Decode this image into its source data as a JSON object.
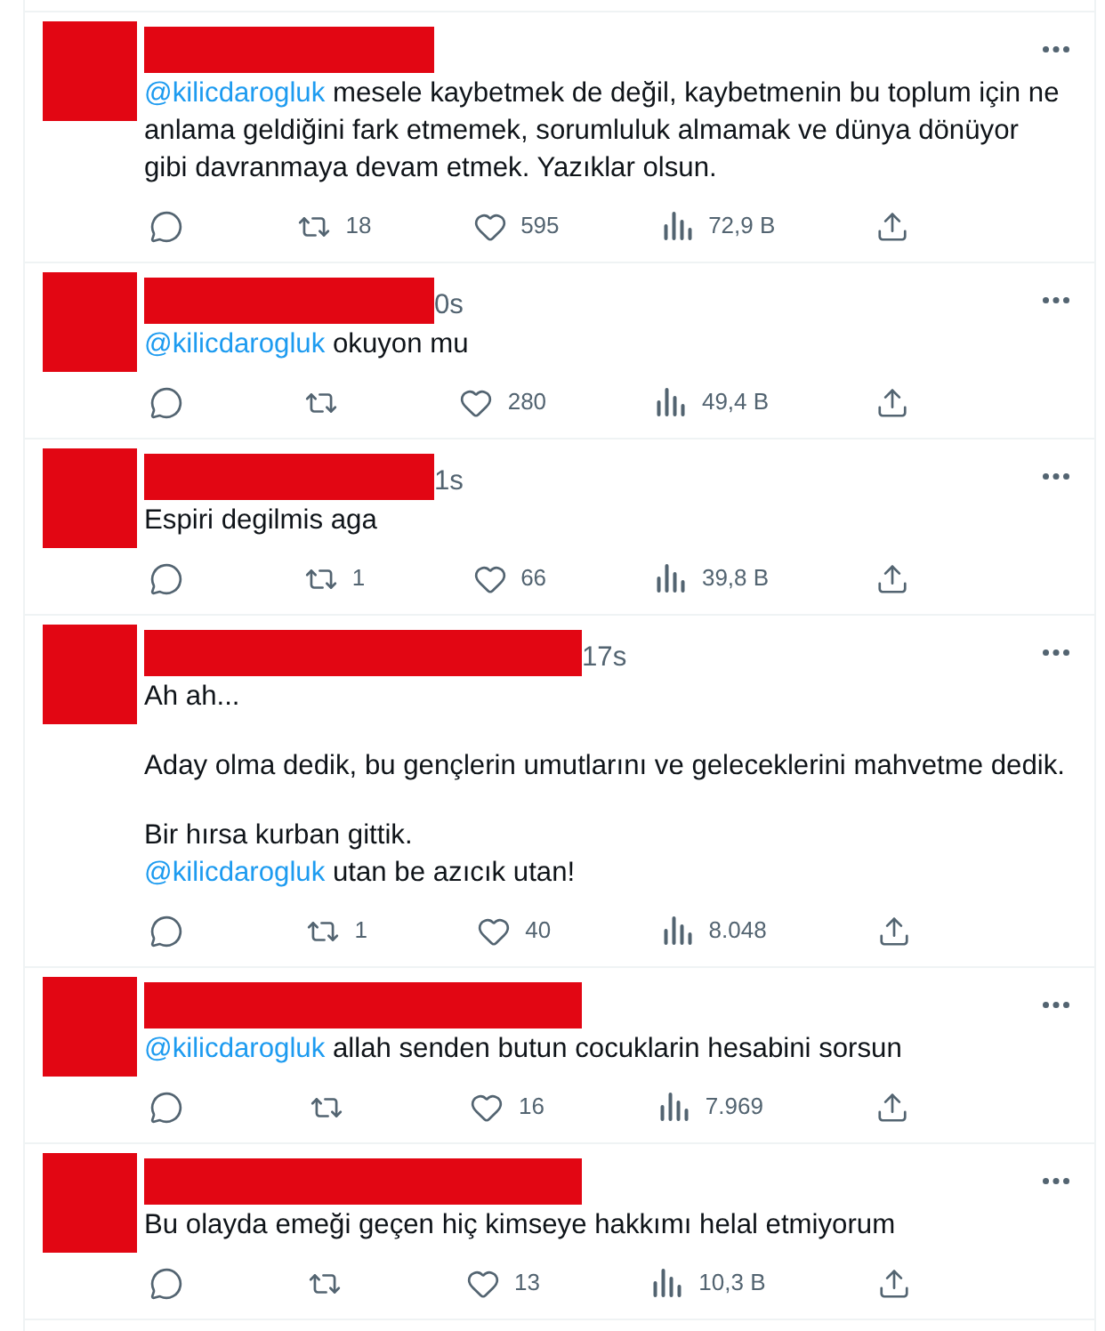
{
  "tweets": [
    {
      "kind": "short",
      "paragraphs": [
        [
          {
            "mention": "@kilicdarogluk",
            "text": "mesele kaybetmek de değil, kaybetmenin bu toplum için ne anlama geldiğini fark etmemek, sorumluluk almamak ve dünya dönüyor"
          },
          {
            "text": "gibi davranmaya devam etmek. Yazıklar olsun."
          }
        ]
      ],
      "retweets": "18",
      "likes": "595",
      "views": "72,9 B"
    },
    {
      "kind": "short",
      "time": "0s",
      "paragraphs": [
        [
          {
            "mention": "@kilicdarogluk",
            "text": "okuyon mu"
          }
        ]
      ],
      "likes": "280",
      "views": "49,4 B"
    },
    {
      "kind": "short",
      "time": "1s",
      "paragraphs": [
        [
          {
            "text": "Espiri degilmis aga"
          }
        ]
      ],
      "retweets": "1",
      "likes": "66",
      "views": "39,8 B"
    },
    {
      "kind": "long",
      "time": "17s",
      "paragraphs": [
        [
          {
            "text": "Ah ah..."
          }
        ],
        [
          {
            "text": "Aday olma dedik, bu gençlerin umutlarını ve geleceklerini mahvetme dedik."
          }
        ],
        [
          {
            "text": "Bir hırsa kurban gittik."
          },
          {
            "mention": "@kilicdarogluk",
            "text": "utan be azıcık utan!"
          }
        ]
      ],
      "retweets": "1",
      "likes": "40",
      "views": "8.048"
    },
    {
      "kind": "long",
      "paragraphs": [
        [
          {
            "mention": "@kilicdarogluk",
            "text": "allah senden butun cocuklarin hesabini sorsun"
          }
        ]
      ],
      "likes": "16",
      "views": "7.969"
    },
    {
      "kind": "long",
      "paragraphs": [
        [
          {
            "text": "Bu olayda emeği geçen hiç kimseye hakkımı helal etmiyorum"
          }
        ]
      ],
      "likes": "13",
      "views": "10,3 B"
    }
  ]
}
